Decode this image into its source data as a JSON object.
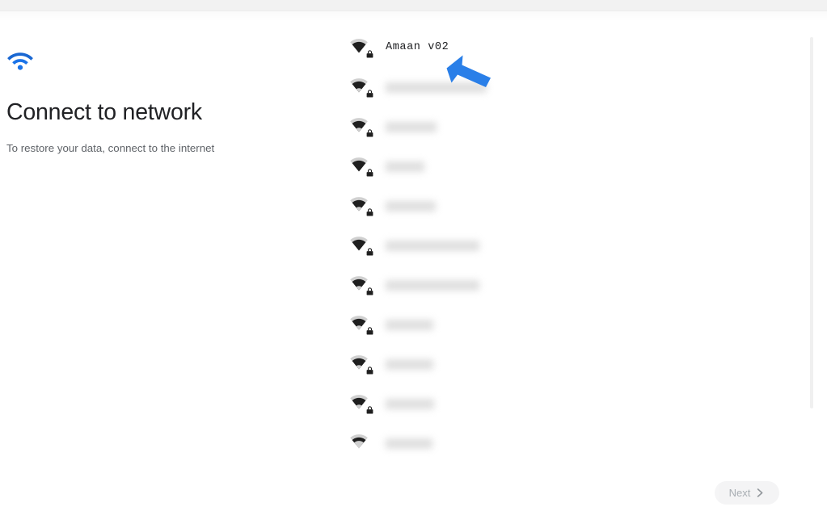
{
  "window": {
    "top_bar_color": "#f2f2f2"
  },
  "header": {
    "icon": "wifi-icon",
    "icon_color": "#1a73e8",
    "title": "Connect to network",
    "subtitle": "To restore your data, connect to the internet"
  },
  "network_list": {
    "row_count": 11,
    "networks": [
      {
        "name": "Amaan v02",
        "redacted": false,
        "secured": true,
        "signal": 4,
        "icon": "wifi-lock-icon",
        "width": 0
      },
      {
        "name": "",
        "redacted": true,
        "secured": true,
        "signal": 3,
        "icon": "wifi-lock-icon",
        "width": 125
      },
      {
        "name": "",
        "redacted": true,
        "secured": true,
        "signal": 3,
        "icon": "wifi-lock-icon",
        "width": 63
      },
      {
        "name": "",
        "redacted": true,
        "secured": true,
        "signal": 4,
        "icon": "wifi-lock-icon",
        "width": 48
      },
      {
        "name": "",
        "redacted": true,
        "secured": true,
        "signal": 3,
        "icon": "wifi-lock-icon",
        "width": 62
      },
      {
        "name": "",
        "redacted": true,
        "secured": true,
        "signal": 4,
        "icon": "wifi-lock-icon",
        "width": 116
      },
      {
        "name": "",
        "redacted": true,
        "secured": true,
        "signal": 3,
        "icon": "wifi-lock-icon",
        "width": 116
      },
      {
        "name": "",
        "redacted": true,
        "secured": true,
        "signal": 3,
        "icon": "wifi-lock-icon",
        "width": 59
      },
      {
        "name": "",
        "redacted": true,
        "secured": true,
        "signal": 3,
        "icon": "wifi-lock-icon",
        "width": 59
      },
      {
        "name": "",
        "redacted": true,
        "secured": true,
        "signal": 3,
        "icon": "wifi-lock-icon",
        "width": 60
      },
      {
        "name": "",
        "redacted": true,
        "secured": false,
        "signal": 2,
        "icon": "wifi-icon",
        "width": 58
      }
    ]
  },
  "annotation": {
    "type": "arrow",
    "color": "#1a73e8",
    "points_at": "Amaan v02"
  },
  "footer": {
    "next_label": "Next",
    "next_icon": "chevron-right-icon",
    "next_disabled": true
  },
  "scrollbar": {
    "orientation": "vertical",
    "color": "#f0f0f0"
  }
}
